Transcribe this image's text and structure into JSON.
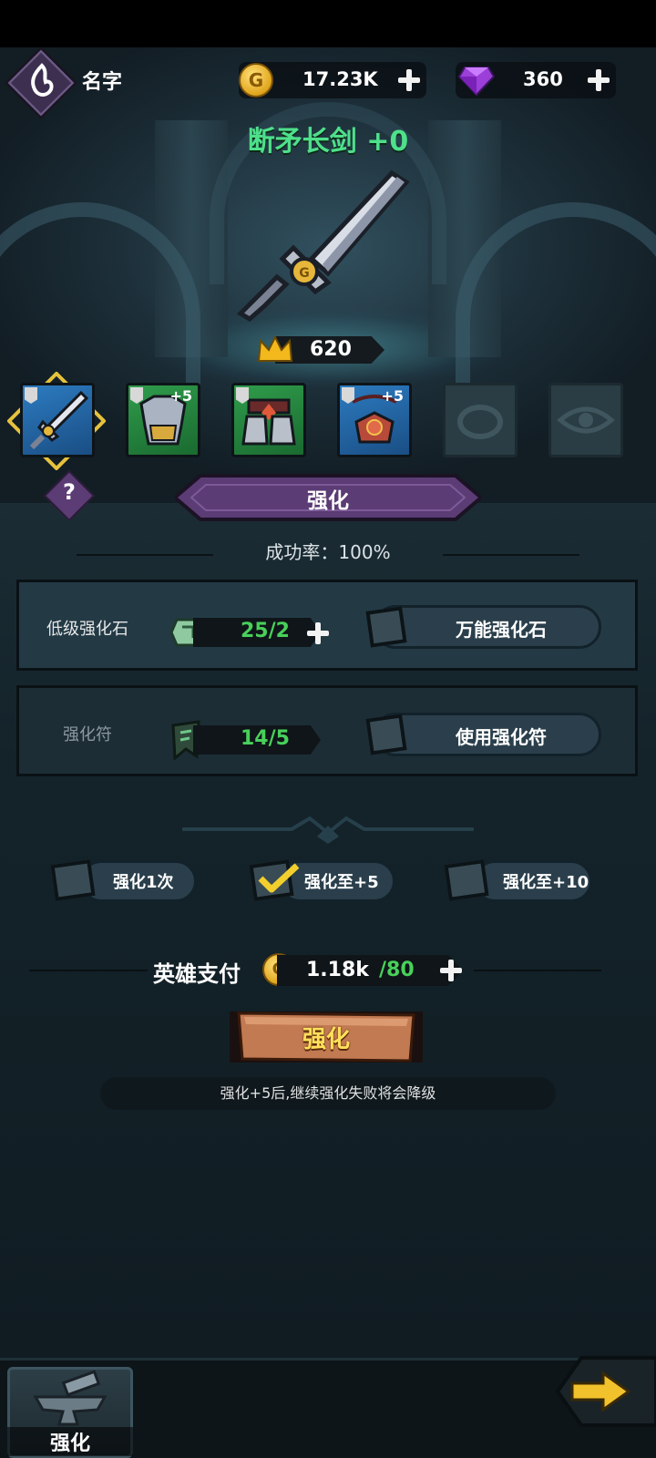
{
  "player": {
    "name": "名字",
    "avatar_icon": "flame-rune-icon"
  },
  "resources": {
    "gold": "17.23K",
    "gems": "360",
    "coin_glyph": "G"
  },
  "item": {
    "title": "断矛长剑 +0",
    "power": "620"
  },
  "equipment_slots": [
    {
      "name": "sword",
      "level": "",
      "rarity": "blue",
      "selected": true
    },
    {
      "name": "armor",
      "level": "+5",
      "rarity": "green"
    },
    {
      "name": "boots",
      "level": "",
      "rarity": "green"
    },
    {
      "name": "amulet",
      "level": "+5",
      "rarity": "blue"
    },
    {
      "name": "ring",
      "level": "",
      "rarity": "empty"
    },
    {
      "name": "eye-charm",
      "level": "",
      "rarity": "empty"
    }
  ],
  "enhance": {
    "section_title": "强化",
    "help_label": "?",
    "success_rate": "成功率：100%",
    "stone": {
      "label": "低级强化石",
      "count": "25/2",
      "option": "万能强化石"
    },
    "charm": {
      "label": "强化符",
      "count": "14/5",
      "option": "使用强化符"
    },
    "modes": [
      {
        "label": "强化1次",
        "checked": false
      },
      {
        "label": "强化至+5",
        "checked": true
      },
      {
        "label": "强化至+10",
        "checked": false
      }
    ],
    "payment": {
      "label": "英雄支付",
      "cost": "1.18k",
      "have": "/80"
    },
    "button": "强化",
    "warning": "强化+5后,继续强化失败将会降级"
  },
  "bottom_nav": {
    "tab": "强化"
  },
  "colors": {
    "accent_green": "#4ee08a",
    "count_green": "#48d05a",
    "button_orange": "#c27a52",
    "ribbon_purple": "#5b3c74"
  }
}
